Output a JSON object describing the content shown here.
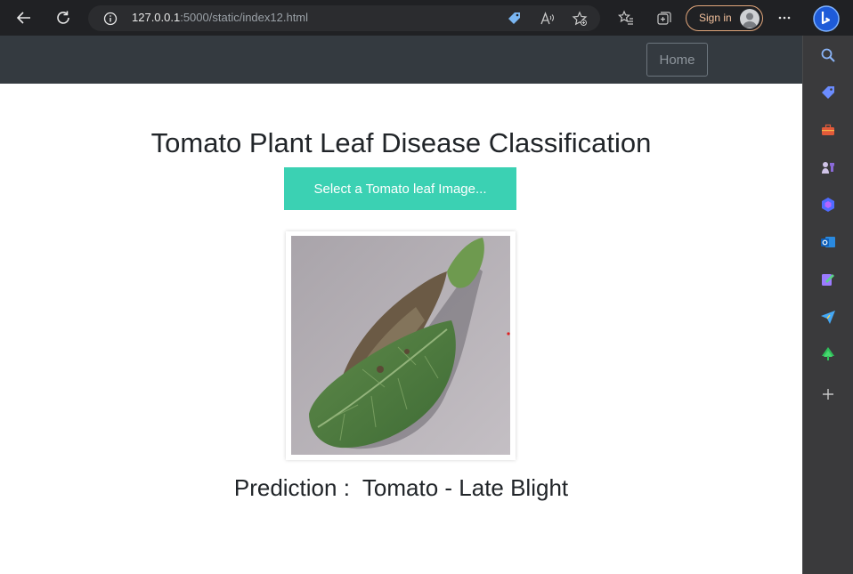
{
  "browser": {
    "url_host": "127.0.0.1",
    "url_rest": ":5000/static/index12.html",
    "signin_label": "Sign in",
    "toolbar_icons": [
      "back-arrow-icon",
      "refresh-icon",
      "info-icon",
      "tag-icon",
      "read-aloud-icon",
      "favorite-add-icon",
      "favorites-icon",
      "collections-icon",
      "more-icon",
      "bing-icon"
    ],
    "accent": "#e0a57a"
  },
  "sidebar": {
    "items": [
      "search-icon",
      "shopping-tag-icon",
      "tools-icon",
      "games-icon",
      "copilot-icon",
      "outlook-icon",
      "designer-icon",
      "send-icon",
      "tree-icon",
      "add-icon"
    ]
  },
  "page": {
    "nav": {
      "home_label": "Home"
    },
    "title": "Tomato Plant Leaf Disease Classification",
    "select_button": "Select a Tomato leaf Image...",
    "image_alt": "tomato leaf photo",
    "prediction": "Prediction :  Tomato - Late Blight",
    "colors": {
      "navbar": "#343a40",
      "button": "#3bd1b3"
    }
  }
}
